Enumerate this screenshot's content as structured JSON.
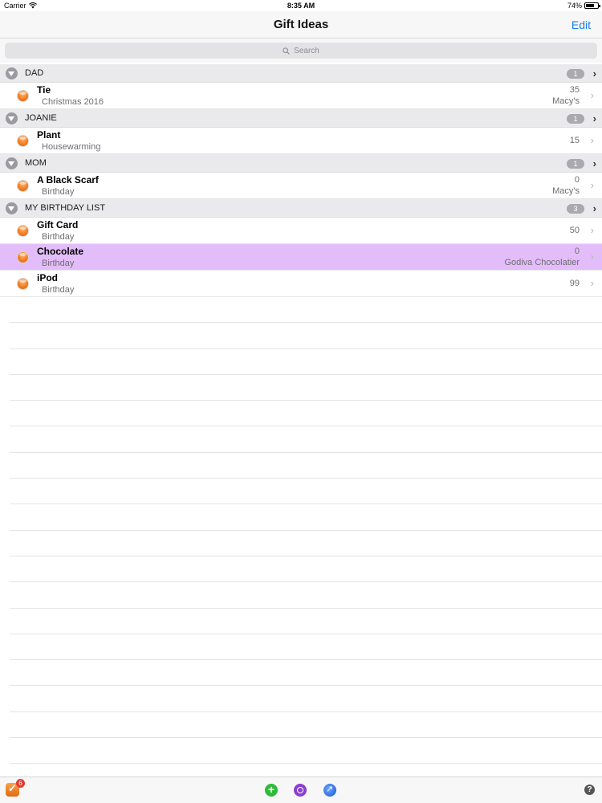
{
  "status_bar": {
    "carrier": "Carrier",
    "time": "8:35 AM",
    "battery": "74%",
    "battery_level": 0.74
  },
  "nav": {
    "title": "Gift Ideas",
    "edit_label": "Edit"
  },
  "search": {
    "placeholder": "Search"
  },
  "sections": [
    {
      "name": "DAD",
      "count": "1",
      "items": [
        {
          "name": "Tie",
          "occasion": "Christmas 2016",
          "price": "35",
          "store": "Macy's"
        }
      ]
    },
    {
      "name": "JOANIE",
      "count": "1",
      "items": [
        {
          "name": "Plant",
          "occasion": "Housewarming",
          "price": "15",
          "store": ""
        }
      ]
    },
    {
      "name": "MOM",
      "count": "1",
      "items": [
        {
          "name": "A Black Scarf",
          "occasion": "Birthday",
          "price": "0",
          "store": "Macy's"
        }
      ]
    },
    {
      "name": "MY BIRTHDAY LIST",
      "count": "3",
      "items": [
        {
          "name": "Gift Card",
          "occasion": "Birthday",
          "price": "50",
          "store": ""
        },
        {
          "name": "Chocolate",
          "occasion": "Birthday",
          "price": "0",
          "store": "Godiva Chocolatier",
          "highlighted": true
        },
        {
          "name": "iPod",
          "occasion": "Birthday",
          "price": "99",
          "store": ""
        }
      ]
    }
  ],
  "toolbar": {
    "badge_count": "6",
    "add_icon": "add-icon",
    "target_icon": "target-icon",
    "sync_icon": "sync-icon",
    "help_icon": "help-icon"
  },
  "colors": {
    "accent": "#1a7ee6",
    "highlight": "#e3bdf9",
    "dot": "#f27d22"
  }
}
